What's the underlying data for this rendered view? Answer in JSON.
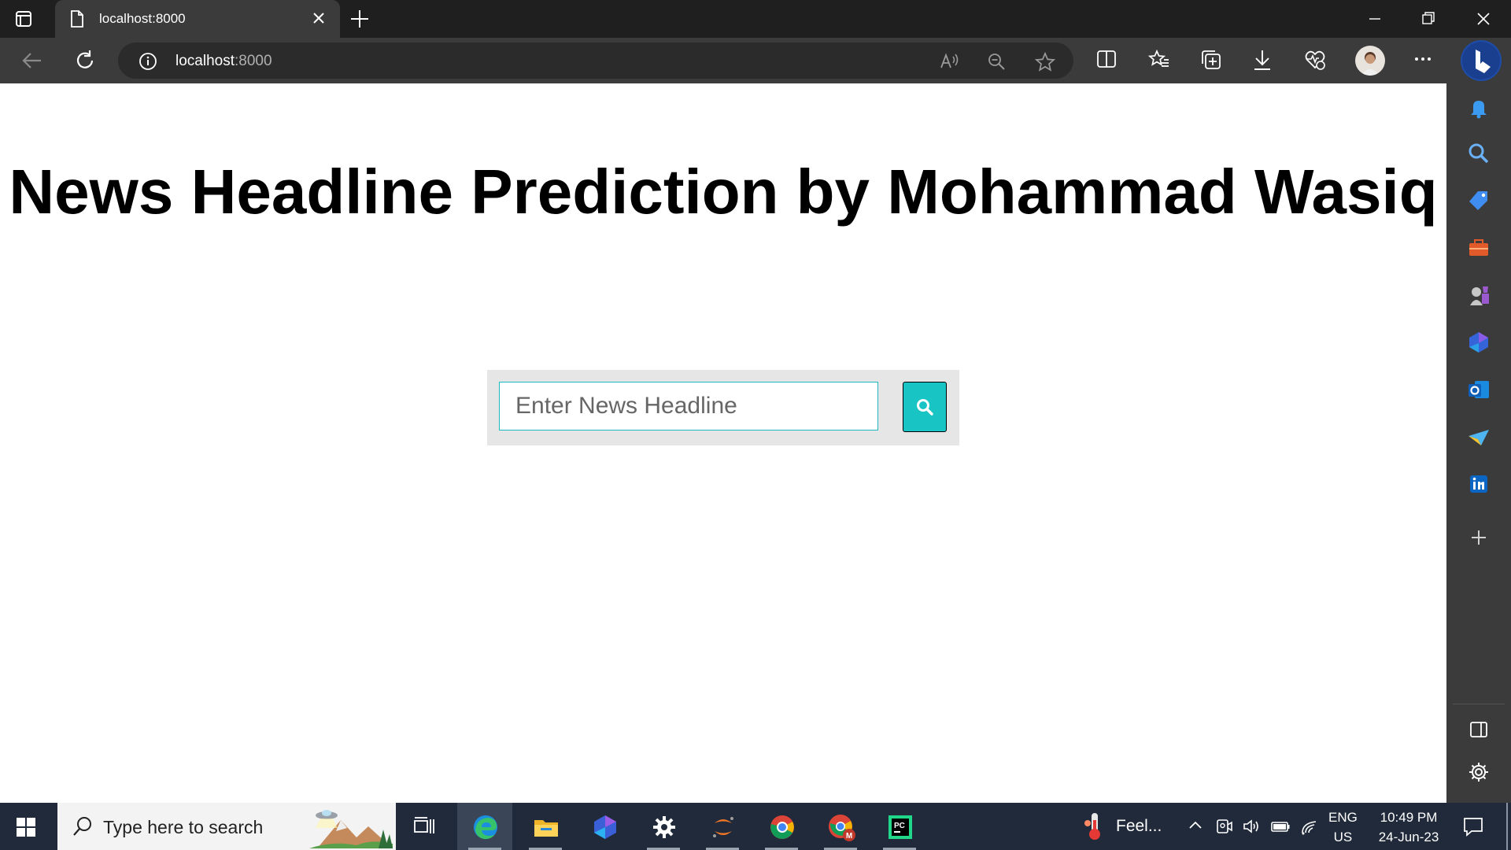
{
  "browser": {
    "tab_title": "localhost:8000",
    "url_host": "localhost",
    "url_port": ":8000"
  },
  "page": {
    "title": "News Headline Prediction by Mohammad Wasiq",
    "input_placeholder": "Enter News Headline",
    "input_value": ""
  },
  "taskbar": {
    "search_placeholder": "Type here to search",
    "weather_text": "Feel...",
    "lang_line1": "ENG",
    "lang_line2": "US",
    "time": "10:49 PM",
    "date": "24-Jun-23"
  },
  "colors": {
    "accent": "#19c4c4",
    "input_border": "#1fb8c2",
    "toolbar": "#3b3b3b",
    "tabstrip": "#1f1f1f",
    "taskbar": "#202a3a"
  },
  "icons": {
    "toolbar": [
      "back-icon",
      "refresh-icon",
      "info-icon",
      "read-aloud-icon",
      "zoom-out-icon",
      "favorite-star-icon",
      "split-screen-icon",
      "favorites-icon",
      "collections-icon",
      "download-icon",
      "performance-icon",
      "profile-avatar",
      "more-icon",
      "bing-icon"
    ],
    "sidebar": [
      "bell-icon",
      "search-icon",
      "shopping-icon",
      "tools-icon",
      "games-icon",
      "copilot-icon",
      "outlook-icon",
      "send-icon",
      "linkedin-icon",
      "add-icon",
      "sidebar-toggle-icon",
      "settings-icon"
    ],
    "taskbar": [
      "windows-start-icon",
      "task-view-icon",
      "edge-icon",
      "file-explorer-icon",
      "copilot-icon",
      "settings-gear-icon",
      "jupyter-icon",
      "chrome-icon",
      "chrome-profile-icon",
      "pycharm-icon"
    ]
  }
}
